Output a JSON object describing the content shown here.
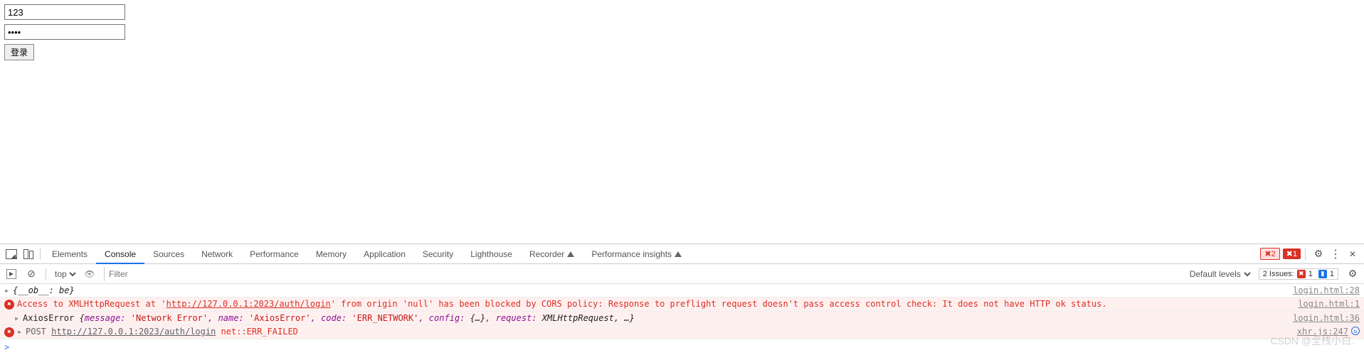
{
  "form": {
    "username": "123",
    "password_mask": "••••",
    "submit": "登录"
  },
  "devtools": {
    "tabs": [
      "Elements",
      "Console",
      "Sources",
      "Network",
      "Performance",
      "Memory",
      "Application",
      "Security",
      "Lighthouse",
      "Recorder",
      "Performance insights"
    ],
    "active_tab": "Console",
    "error_count": "2",
    "error_box_count": "1",
    "subbar": {
      "context": "top",
      "filter_placeholder": "Filter",
      "levels": "Default levels",
      "issues_label": "2 Issues:",
      "issues_err": "1",
      "issues_info": "1"
    }
  },
  "logs": {
    "ob": "{__ob__: be}",
    "ob_src": "login.html:28",
    "cors_pre": "Access to XMLHttpRequest at '",
    "cors_url": "http://127.0.0.1:2023/auth/login",
    "cors_post": "' from origin 'null' has been blocked by CORS policy: Response to preflight request doesn't pass access control check: It does not have HTTP ok status.",
    "cors_src": "login.html:1",
    "axios_prefix": "AxiosError ",
    "axios_open": "{",
    "axios_k1": "message: ",
    "axios_v1": "'Network Error'",
    "axios_k2": ", name: ",
    "axios_v2": "'AxiosError'",
    "axios_k3": ", code: ",
    "axios_v3": "'ERR_NETWORK'",
    "axios_k4": ", config: ",
    "axios_v4": "{…}",
    "axios_k5": ", request: ",
    "axios_v5": "XMLHttpRequest",
    "axios_k6": ", …}",
    "axios_src": "login.html:36",
    "post_pre": "POST ",
    "post_url": "http://127.0.0.1:2023/auth/login",
    "post_post": " net::ERR_FAILED",
    "post_src": "xhr.js:247"
  },
  "prompt": ">",
  "watermark": "CSDN @全栈小白."
}
